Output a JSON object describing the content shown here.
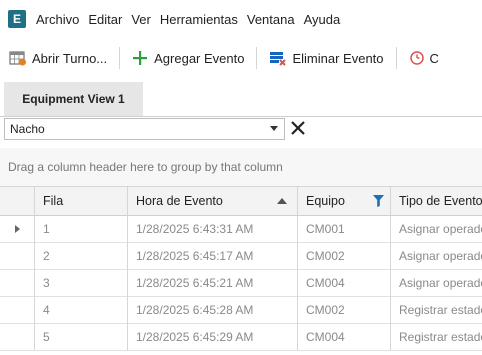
{
  "app": {
    "logo_letter": "E"
  },
  "menu": [
    "Archivo",
    "Editar",
    "Ver",
    "Herramientas",
    "Ventana",
    "Ayuda"
  ],
  "toolbar": {
    "open_shift": "Abrir Turno...",
    "add_event": "Agregar Evento",
    "delete_event": "Eliminar Evento",
    "next_partial": "C"
  },
  "tabs": [
    "Equipment View 1"
  ],
  "filter": {
    "selected": "Nacho"
  },
  "groupby": {
    "hint": "Drag a column header here to group by that column"
  },
  "grid": {
    "columns": [
      "Fila",
      "Hora de Evento",
      "Equipo",
      "Tipo de Evento"
    ],
    "sort_column": "Hora de Evento",
    "sort_direction": "ascending",
    "filtered_column": "Equipo",
    "rows": [
      {
        "fila": "1",
        "hora": "1/28/2025 6:43:31 AM",
        "equipo": "CM001",
        "tipo": "Asignar operador"
      },
      {
        "fila": "2",
        "hora": "1/28/2025 6:45:17 AM",
        "equipo": "CM002",
        "tipo": "Asignar operador"
      },
      {
        "fila": "3",
        "hora": "1/28/2025 6:45:21 AM",
        "equipo": "CM004",
        "tipo": "Asignar operador"
      },
      {
        "fila": "4",
        "hora": "1/28/2025 6:45:28 AM",
        "equipo": "CM002",
        "tipo": "Registrar estado"
      },
      {
        "fila": "5",
        "hora": "1/28/2025 6:45:29 AM",
        "equipo": "CM004",
        "tipo": "Registrar estado"
      }
    ]
  },
  "colors": {
    "accent": "#1f6f86",
    "add_icon": "#2e9e3e",
    "delete_icon": "#1565c0",
    "clock_icon": "#d9534f"
  }
}
